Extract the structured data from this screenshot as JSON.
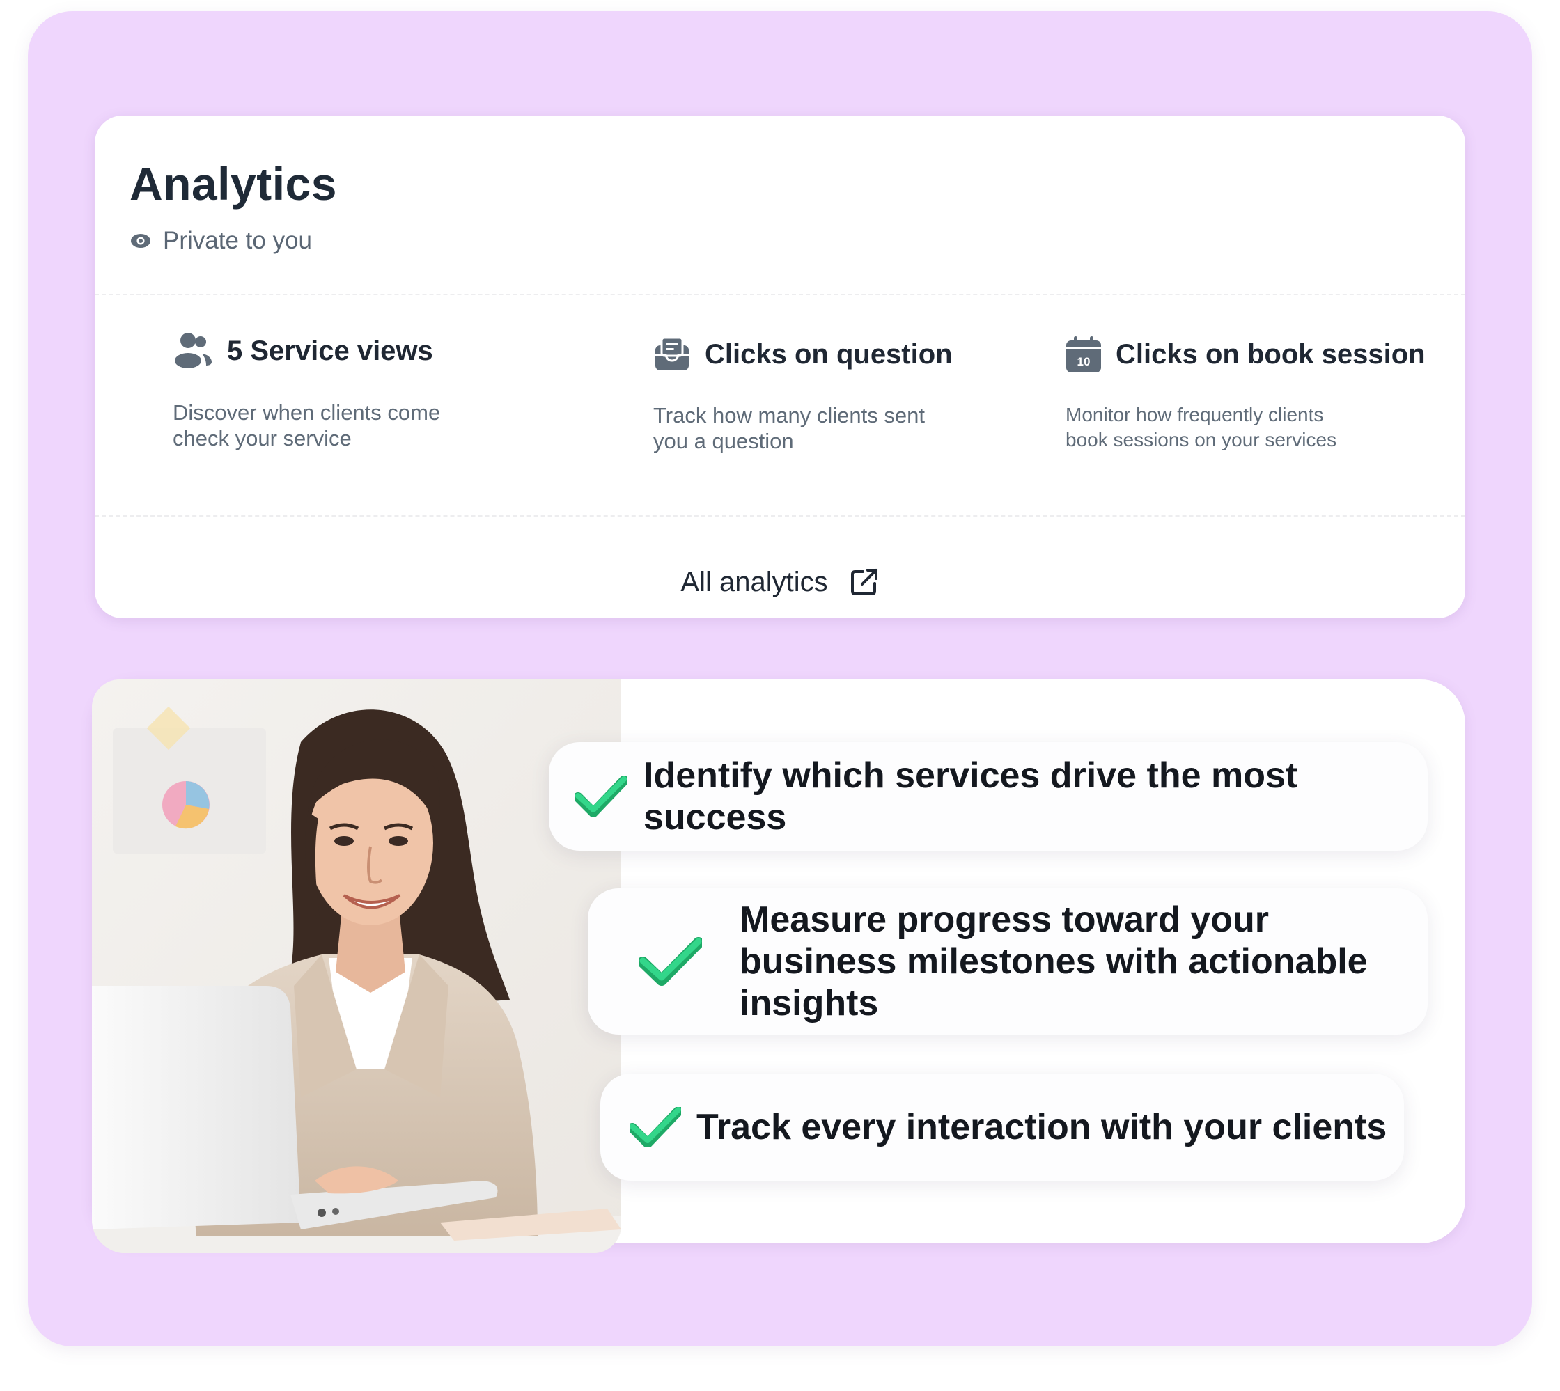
{
  "analytics": {
    "title": "Analytics",
    "privacy_label": "Private to you",
    "stats": [
      {
        "label": "5 Service views",
        "icon": "users-icon",
        "description": "Discover when clients come check your service"
      },
      {
        "label": "Clicks on question",
        "icon": "inbox-icon",
        "description": "Track how many clients sent you a question"
      },
      {
        "label": "Clicks on book session",
        "icon": "calendar-icon",
        "calendar_day": "10",
        "description": "Monitor how frequently clients book sessions on your services"
      }
    ],
    "all_link_label": "All analytics"
  },
  "features": [
    {
      "text": "Identify which services drive the most success"
    },
    {
      "text": "Measure progress toward your business milestones with actionable insights"
    },
    {
      "text": "Track every interaction with your clients"
    }
  ],
  "colors": {
    "background": "#efd6fd",
    "card": "#ffffff",
    "check_green": "#22c77a",
    "icon_gray": "#5f6b78"
  }
}
